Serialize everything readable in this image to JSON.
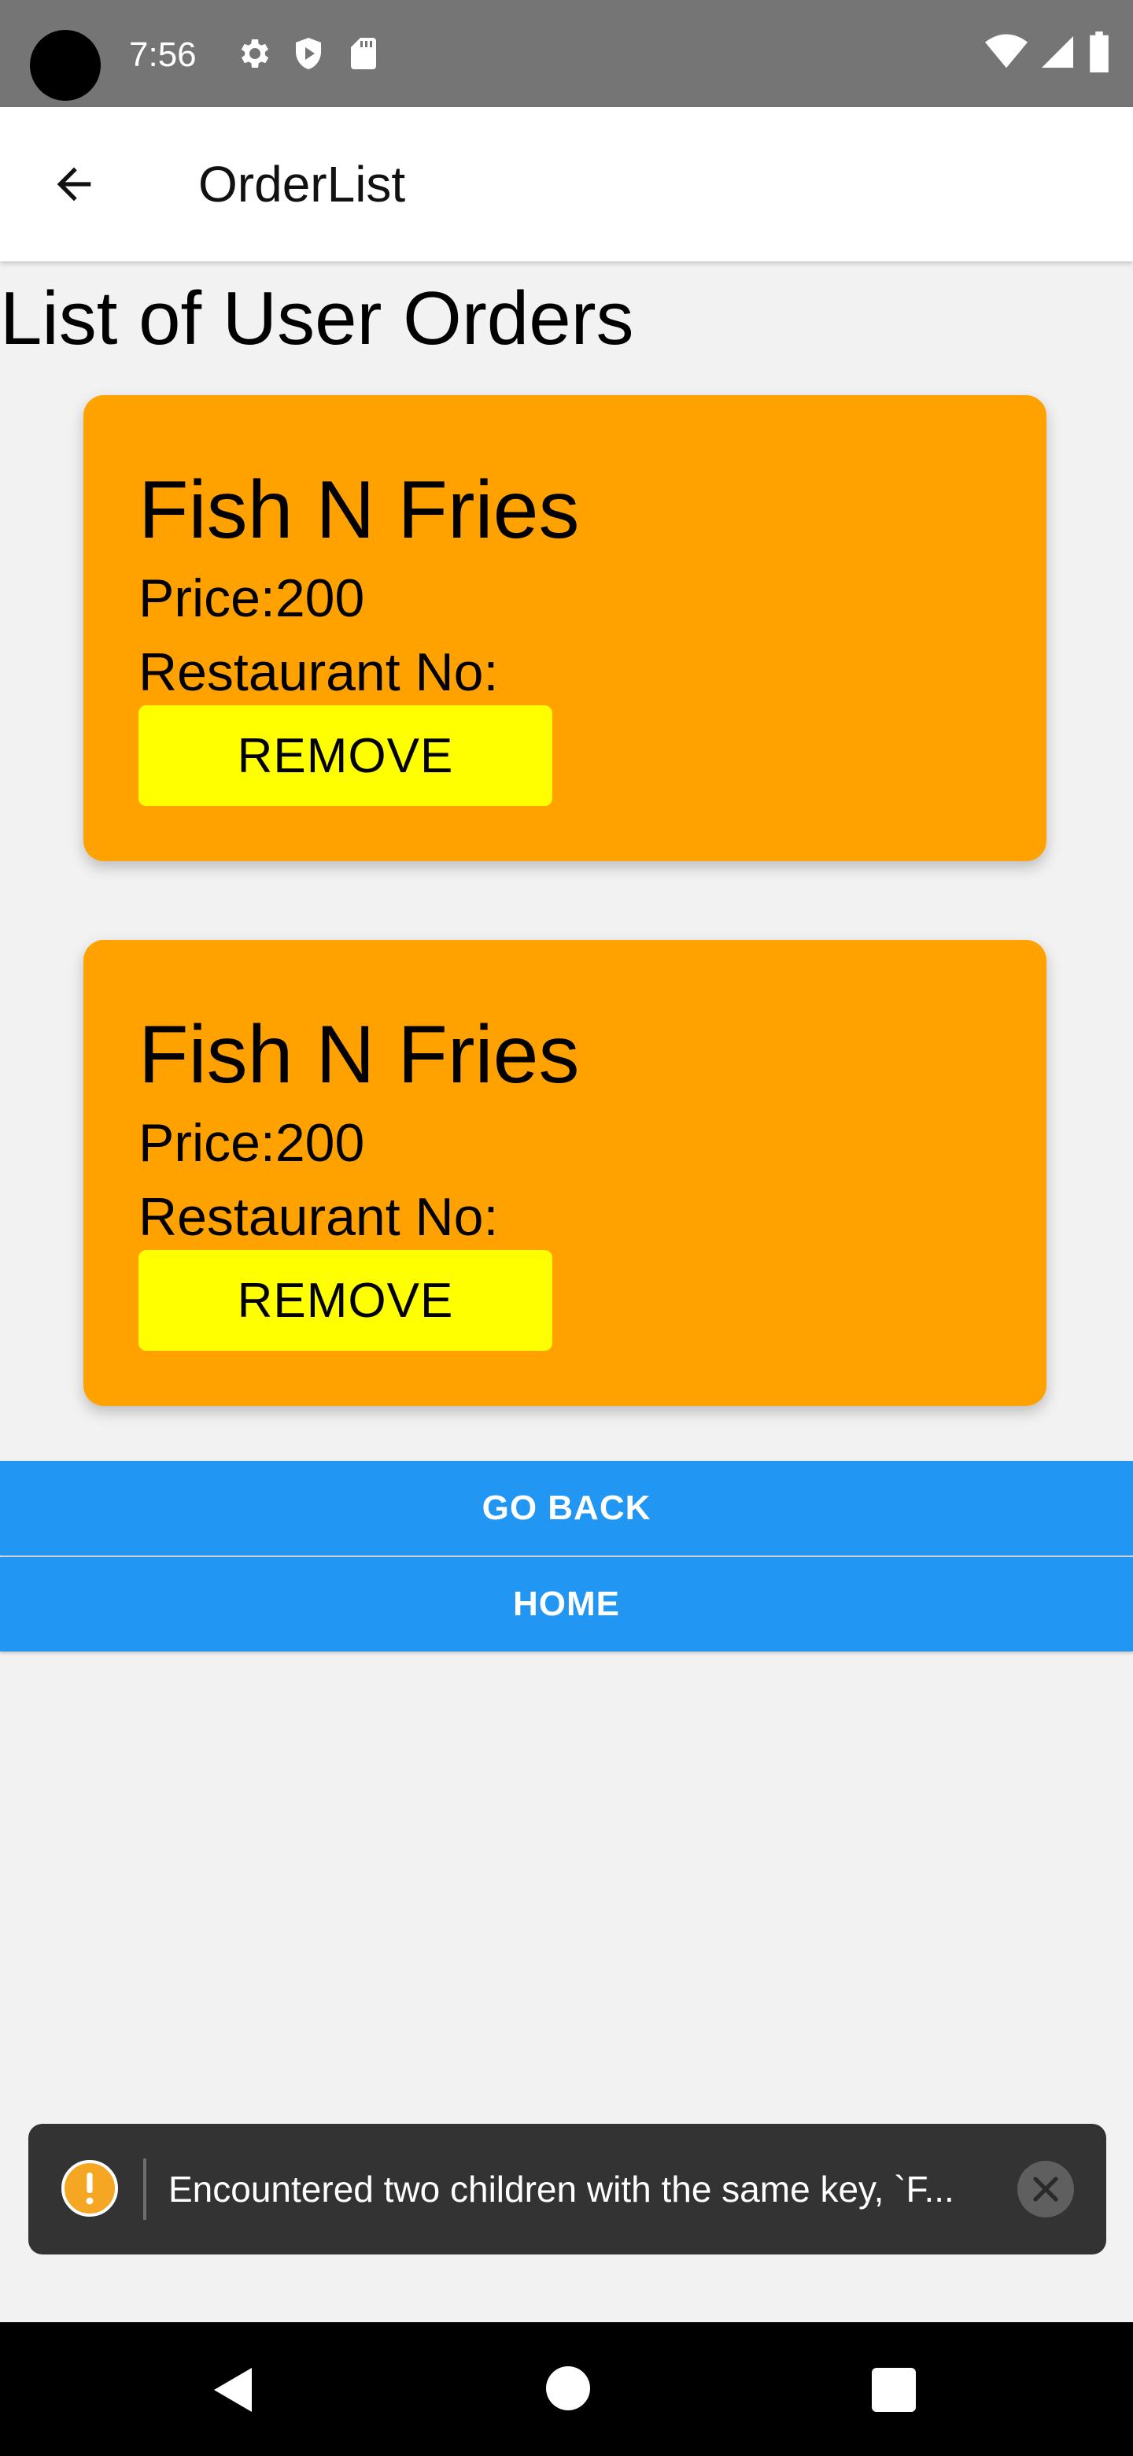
{
  "status_bar": {
    "time": "7:56",
    "left_icons": [
      "settings-icon",
      "shield-icon",
      "sd-card-icon"
    ],
    "right_icons": [
      "wifi-icon",
      "signal-icon",
      "battery-icon"
    ]
  },
  "app_bar": {
    "title": "OrderList",
    "back_icon": "arrow-back-icon"
  },
  "page": {
    "heading": "List of User Orders"
  },
  "orders": [
    {
      "name": "Fish N Fries",
      "price": "Price:200",
      "restaurant": "Restaurant No:",
      "remove_label": "REMOVE"
    },
    {
      "name": "Fish N Fries",
      "price": "Price:200",
      "restaurant": "Restaurant No:",
      "remove_label": "REMOVE"
    }
  ],
  "buttons": {
    "go_back": "GO BACK",
    "home": "HOME"
  },
  "toast": {
    "message": "Encountered two children with the same key, `F...",
    "icon": "warning-icon",
    "close_icon": "close-icon"
  },
  "nav_bar": {
    "icons": [
      "nav-back-icon",
      "nav-home-icon",
      "nav-recents-icon"
    ]
  },
  "colors": {
    "status_bar": "#757575",
    "card": "#ffa200",
    "remove_button": "#ffff00",
    "primary_button": "#2196f3",
    "toast": "#333333",
    "warning": "#f5a623"
  }
}
